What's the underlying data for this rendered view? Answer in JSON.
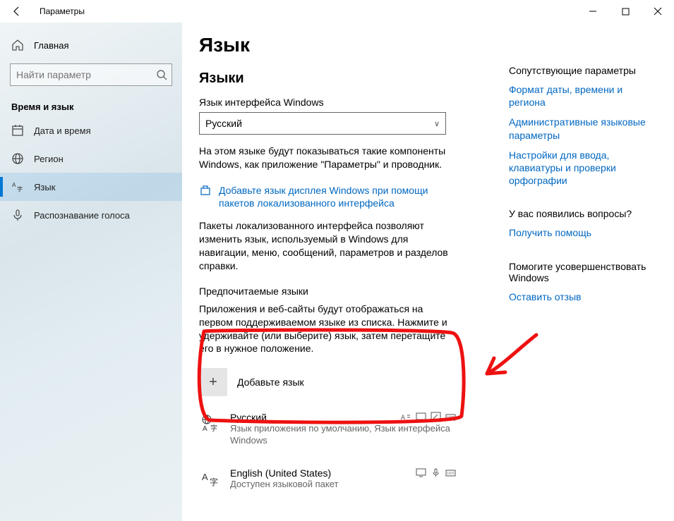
{
  "app": {
    "title": "Параметры"
  },
  "sidebar": {
    "home": "Главная",
    "search_placeholder": "Найти параметр",
    "category": "Время и язык",
    "items": [
      {
        "label": "Дата и время"
      },
      {
        "label": "Регион"
      },
      {
        "label": "Язык"
      },
      {
        "label": "Распознавание голоса"
      }
    ]
  },
  "page": {
    "h1": "Язык",
    "h2": "Языки",
    "display_lang_label": "Язык интерфейса Windows",
    "display_lang_value": "Русский",
    "display_lang_desc": "На этом языке будут показываться такие компоненты Windows, как приложение \"Параметры\" и проводник.",
    "tip_link": "Добавьте язык дисплея Windows при помощи пакетов локализованного интерфейса",
    "lip_desc": "Пакеты локализованного интерфейса позволяют изменить язык, используемый в Windows для навигации, меню, сообщений, параметров и разделов справки.",
    "pref_h3": "Предпочитаемые языки",
    "pref_desc": "Приложения и веб-сайты будут отображаться на первом поддерживаемом языке из списка. Нажмите и удерживайте (или выберите) язык, затем перетащите его в нужное положение.",
    "add_lang": "Добавьте язык",
    "languages": [
      {
        "name": "Русский",
        "sub": "Язык приложения по умолчанию, Язык интерфейса Windows"
      },
      {
        "name": "English (United States)",
        "sub": "Доступен языковой пакет"
      }
    ]
  },
  "right": {
    "related_title": "Сопутствующие параметры",
    "links1": [
      "Формат даты, времени и региона",
      "Административные языковые параметры",
      "Настройки для ввода, клавиатуры и проверки орфографии"
    ],
    "help_title": "У вас появились вопросы?",
    "help_link": "Получить помощь",
    "feedback_title": "Помогите усовершенствовать Windows",
    "feedback_link": "Оставить отзыв"
  }
}
